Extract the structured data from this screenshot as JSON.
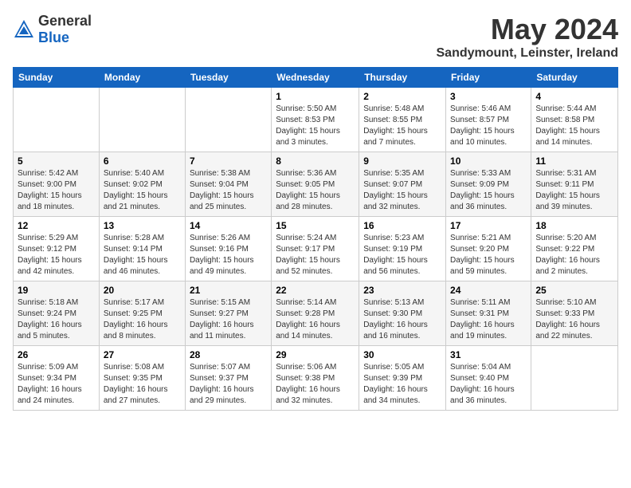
{
  "logo": {
    "general": "General",
    "blue": "Blue"
  },
  "title": "May 2024",
  "subtitle": "Sandymount, Leinster, Ireland",
  "days_of_week": [
    "Sunday",
    "Monday",
    "Tuesday",
    "Wednesday",
    "Thursday",
    "Friday",
    "Saturday"
  ],
  "weeks": [
    [
      {
        "day": "",
        "info": ""
      },
      {
        "day": "",
        "info": ""
      },
      {
        "day": "",
        "info": ""
      },
      {
        "day": "1",
        "info": "Sunrise: 5:50 AM\nSunset: 8:53 PM\nDaylight: 15 hours\nand 3 minutes."
      },
      {
        "day": "2",
        "info": "Sunrise: 5:48 AM\nSunset: 8:55 PM\nDaylight: 15 hours\nand 7 minutes."
      },
      {
        "day": "3",
        "info": "Sunrise: 5:46 AM\nSunset: 8:57 PM\nDaylight: 15 hours\nand 10 minutes."
      },
      {
        "day": "4",
        "info": "Sunrise: 5:44 AM\nSunset: 8:58 PM\nDaylight: 15 hours\nand 14 minutes."
      }
    ],
    [
      {
        "day": "5",
        "info": "Sunrise: 5:42 AM\nSunset: 9:00 PM\nDaylight: 15 hours\nand 18 minutes."
      },
      {
        "day": "6",
        "info": "Sunrise: 5:40 AM\nSunset: 9:02 PM\nDaylight: 15 hours\nand 21 minutes."
      },
      {
        "day": "7",
        "info": "Sunrise: 5:38 AM\nSunset: 9:04 PM\nDaylight: 15 hours\nand 25 minutes."
      },
      {
        "day": "8",
        "info": "Sunrise: 5:36 AM\nSunset: 9:05 PM\nDaylight: 15 hours\nand 28 minutes."
      },
      {
        "day": "9",
        "info": "Sunrise: 5:35 AM\nSunset: 9:07 PM\nDaylight: 15 hours\nand 32 minutes."
      },
      {
        "day": "10",
        "info": "Sunrise: 5:33 AM\nSunset: 9:09 PM\nDaylight: 15 hours\nand 36 minutes."
      },
      {
        "day": "11",
        "info": "Sunrise: 5:31 AM\nSunset: 9:11 PM\nDaylight: 15 hours\nand 39 minutes."
      }
    ],
    [
      {
        "day": "12",
        "info": "Sunrise: 5:29 AM\nSunset: 9:12 PM\nDaylight: 15 hours\nand 42 minutes."
      },
      {
        "day": "13",
        "info": "Sunrise: 5:28 AM\nSunset: 9:14 PM\nDaylight: 15 hours\nand 46 minutes."
      },
      {
        "day": "14",
        "info": "Sunrise: 5:26 AM\nSunset: 9:16 PM\nDaylight: 15 hours\nand 49 minutes."
      },
      {
        "day": "15",
        "info": "Sunrise: 5:24 AM\nSunset: 9:17 PM\nDaylight: 15 hours\nand 52 minutes."
      },
      {
        "day": "16",
        "info": "Sunrise: 5:23 AM\nSunset: 9:19 PM\nDaylight: 15 hours\nand 56 minutes."
      },
      {
        "day": "17",
        "info": "Sunrise: 5:21 AM\nSunset: 9:20 PM\nDaylight: 15 hours\nand 59 minutes."
      },
      {
        "day": "18",
        "info": "Sunrise: 5:20 AM\nSunset: 9:22 PM\nDaylight: 16 hours\nand 2 minutes."
      }
    ],
    [
      {
        "day": "19",
        "info": "Sunrise: 5:18 AM\nSunset: 9:24 PM\nDaylight: 16 hours\nand 5 minutes."
      },
      {
        "day": "20",
        "info": "Sunrise: 5:17 AM\nSunset: 9:25 PM\nDaylight: 16 hours\nand 8 minutes."
      },
      {
        "day": "21",
        "info": "Sunrise: 5:15 AM\nSunset: 9:27 PM\nDaylight: 16 hours\nand 11 minutes."
      },
      {
        "day": "22",
        "info": "Sunrise: 5:14 AM\nSunset: 9:28 PM\nDaylight: 16 hours\nand 14 minutes."
      },
      {
        "day": "23",
        "info": "Sunrise: 5:13 AM\nSunset: 9:30 PM\nDaylight: 16 hours\nand 16 minutes."
      },
      {
        "day": "24",
        "info": "Sunrise: 5:11 AM\nSunset: 9:31 PM\nDaylight: 16 hours\nand 19 minutes."
      },
      {
        "day": "25",
        "info": "Sunrise: 5:10 AM\nSunset: 9:33 PM\nDaylight: 16 hours\nand 22 minutes."
      }
    ],
    [
      {
        "day": "26",
        "info": "Sunrise: 5:09 AM\nSunset: 9:34 PM\nDaylight: 16 hours\nand 24 minutes."
      },
      {
        "day": "27",
        "info": "Sunrise: 5:08 AM\nSunset: 9:35 PM\nDaylight: 16 hours\nand 27 minutes."
      },
      {
        "day": "28",
        "info": "Sunrise: 5:07 AM\nSunset: 9:37 PM\nDaylight: 16 hours\nand 29 minutes."
      },
      {
        "day": "29",
        "info": "Sunrise: 5:06 AM\nSunset: 9:38 PM\nDaylight: 16 hours\nand 32 minutes."
      },
      {
        "day": "30",
        "info": "Sunrise: 5:05 AM\nSunset: 9:39 PM\nDaylight: 16 hours\nand 34 minutes."
      },
      {
        "day": "31",
        "info": "Sunrise: 5:04 AM\nSunset: 9:40 PM\nDaylight: 16 hours\nand 36 minutes."
      },
      {
        "day": "",
        "info": ""
      }
    ]
  ]
}
